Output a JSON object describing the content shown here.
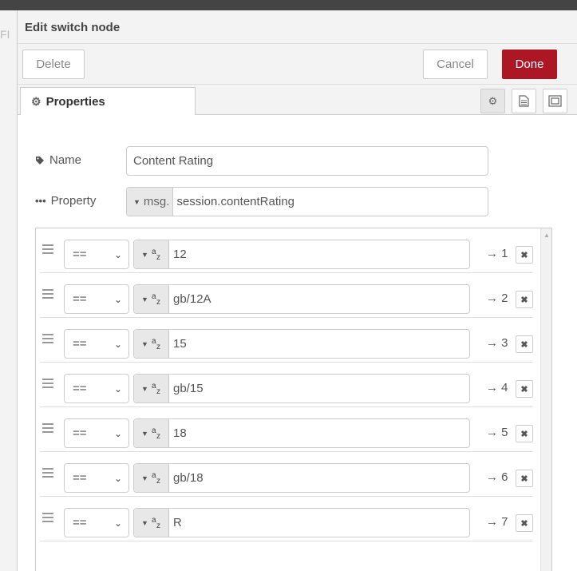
{
  "canvas_edge_text": "FI",
  "tray": {
    "title": "Edit switch node",
    "delete_label": "Delete",
    "cancel_label": "Cancel",
    "done_label": "Done"
  },
  "tabs": {
    "properties_label": "Properties"
  },
  "form": {
    "name_label": "Name",
    "name_value": "Content Rating",
    "property_label": "Property",
    "property_prefix": "msg.",
    "property_value": "session.contentRating"
  },
  "rules": [
    {
      "operator": "==",
      "value": "12",
      "output": "→ 1"
    },
    {
      "operator": "==",
      "value": "gb/12A",
      "output": "→ 2"
    },
    {
      "operator": "==",
      "value": "15",
      "output": "→ 3"
    },
    {
      "operator": "==",
      "value": "gb/15",
      "output": "→ 4"
    },
    {
      "operator": "==",
      "value": "18",
      "output": "→ 5"
    },
    {
      "operator": "==",
      "value": "gb/18",
      "output": "→ 6"
    },
    {
      "operator": "==",
      "value": "R",
      "output": "→ 7"
    }
  ],
  "colors": {
    "accent": "#ad1625",
    "topbar": "#444444"
  },
  "icons": [
    "gear-icon",
    "document-icon",
    "frame-icon",
    "tag-icon",
    "dots-icon",
    "drag-handle-icon",
    "chevron-down-icon",
    "caret-down-icon",
    "string-type-icon",
    "close-icon"
  ]
}
